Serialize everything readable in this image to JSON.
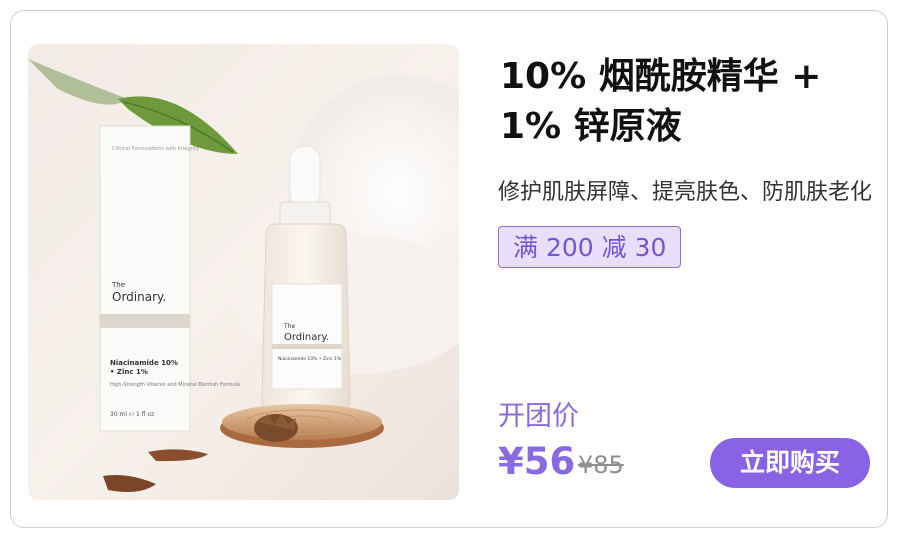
{
  "product": {
    "title_line1": "10% 烟酰胺精华 +",
    "title_line2": "1% 锌原液",
    "subtitle": "修护肌肤屏障、提亮肤色、防肌肤老化",
    "promo": "满 200 减 30",
    "image": {
      "box_brand_small": "The",
      "box_brand": "Ordinary.",
      "box_tagline": "Clinical Formulations with Integrity",
      "box_name_line1": "Niacinamide 10%",
      "box_name_line2": "• Zinc 1%",
      "box_desc": "High-Strength Vitamin and Mineral Blemish Formula",
      "box_volume": "30 ml ℮   1 fl oz",
      "bottle_brand_small": "The",
      "bottle_brand": "Ordinary.",
      "bottle_name": "Niacinamide 10% • Zinc 1%"
    }
  },
  "pricing": {
    "label": "开团价",
    "current": "¥56",
    "original": "¥85"
  },
  "actions": {
    "buy_label": "立即购买"
  },
  "colors": {
    "accent": "#8a62e6",
    "badge_bg": "#e8e0fb",
    "badge_text": "#7653d8"
  }
}
